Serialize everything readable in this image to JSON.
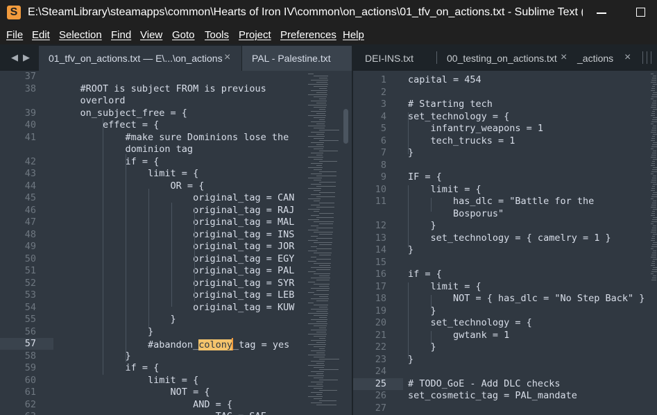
{
  "window": {
    "title": "E:\\SteamLibrary\\steamapps\\common\\Hearts of Iron IV\\common\\on_actions\\01_tfv_on_actions.txt - Sublime Text (UNR...",
    "app_icon": "S"
  },
  "menu": [
    "File",
    "Edit",
    "Selection",
    "Find",
    "View",
    "Goto",
    "Tools",
    "Project",
    "Preferences",
    "Help"
  ],
  "tabs": [
    {
      "label": "01_tfv_on_actions.txt — E\\...\\on_actions",
      "close": "×",
      "state": "active"
    },
    {
      "label": "PAL - Palestine.txt",
      "close": "",
      "state": "light"
    },
    {
      "label": "DEI-INS.txt",
      "close": "",
      "state": "inactive"
    },
    {
      "label": "00_testing_on_actions.txt",
      "close": "×",
      "state": "inactive"
    },
    {
      "label": "_actions",
      "close": "×",
      "state": "inactive"
    }
  ],
  "left_pane": {
    "current_line": "57",
    "lines": [
      {
        "n": "37",
        "t": ""
      },
      {
        "n": "38",
        "t": "    #ROOT is subject FROM is previous"
      },
      {
        "n": "",
        "t": "    overlord"
      },
      {
        "n": "39",
        "t": "    on_subject_free = {"
      },
      {
        "n": "40",
        "t": "        effect = {"
      },
      {
        "n": "41",
        "t": "            #make sure Dominions lose the"
      },
      {
        "n": "",
        "t": "            dominion tag"
      },
      {
        "n": "42",
        "t": "            if = {"
      },
      {
        "n": "43",
        "t": "                limit = {"
      },
      {
        "n": "44",
        "t": "                    OR = {"
      },
      {
        "n": "45",
        "t": "                        original_tag = CAN"
      },
      {
        "n": "46",
        "t": "                        original_tag = RAJ"
      },
      {
        "n": "47",
        "t": "                        original_tag = MAL"
      },
      {
        "n": "48",
        "t": "                        original_tag = INS"
      },
      {
        "n": "49",
        "t": "                        original_tag = JOR"
      },
      {
        "n": "50",
        "t": "                        original_tag = EGY"
      },
      {
        "n": "51",
        "t": "                        original_tag = PAL"
      },
      {
        "n": "52",
        "t": "                        original_tag = SYR"
      },
      {
        "n": "53",
        "t": "                        original_tag = LEB"
      },
      {
        "n": "54",
        "t": "                        original_tag = KUW"
      },
      {
        "n": "55",
        "t": "                    }"
      },
      {
        "n": "56",
        "t": "                }"
      },
      {
        "n": "57",
        "t": "                #abandon_colony_tag = yes"
      },
      {
        "n": "58",
        "t": "            }"
      },
      {
        "n": "59",
        "t": "            if = {"
      },
      {
        "n": "60",
        "t": "                limit = {"
      },
      {
        "n": "61",
        "t": "                    NOT = {"
      },
      {
        "n": "62",
        "t": "                        AND = {"
      },
      {
        "n": "63",
        "t": "                            TAG = SAF"
      }
    ],
    "highlight_word": "colony"
  },
  "right_pane": {
    "current_line": "25",
    "lines": [
      {
        "n": "1",
        "t": "capital = 454"
      },
      {
        "n": "2",
        "t": ""
      },
      {
        "n": "3",
        "t": "# Starting tech"
      },
      {
        "n": "4",
        "t": "set_technology = {"
      },
      {
        "n": "5",
        "t": "    infantry_weapons = 1"
      },
      {
        "n": "6",
        "t": "    tech_trucks = 1"
      },
      {
        "n": "7",
        "t": "}"
      },
      {
        "n": "8",
        "t": ""
      },
      {
        "n": "9",
        "t": "IF = {"
      },
      {
        "n": "10",
        "t": "    limit = {"
      },
      {
        "n": "11",
        "t": "        has_dlc = \"Battle for the"
      },
      {
        "n": "",
        "t": "        Bosporus\""
      },
      {
        "n": "12",
        "t": "    }"
      },
      {
        "n": "13",
        "t": "    set_technology = { camelry = 1 }"
      },
      {
        "n": "14",
        "t": "}"
      },
      {
        "n": "15",
        "t": ""
      },
      {
        "n": "16",
        "t": "if = {"
      },
      {
        "n": "17",
        "t": "    limit = {"
      },
      {
        "n": "18",
        "t": "        NOT = { has_dlc = \"No Step Back\" }"
      },
      {
        "n": "19",
        "t": "    }"
      },
      {
        "n": "20",
        "t": "    set_technology = {"
      },
      {
        "n": "21",
        "t": "        gwtank = 1"
      },
      {
        "n": "22",
        "t": "    }"
      },
      {
        "n": "23",
        "t": "}"
      },
      {
        "n": "24",
        "t": ""
      },
      {
        "n": "25",
        "t": "# TODO_GoE - Add DLC checks"
      },
      {
        "n": "26",
        "t": "set_cosmetic_tag = PAL_mandate"
      },
      {
        "n": "27",
        "t": ""
      }
    ]
  },
  "icons": {
    "tab_back": "triangle-left-icon",
    "tab_forward": "triangle-right-icon",
    "close": "close-icon",
    "minimize": "minimize-icon",
    "maximize": "maximize-icon"
  }
}
